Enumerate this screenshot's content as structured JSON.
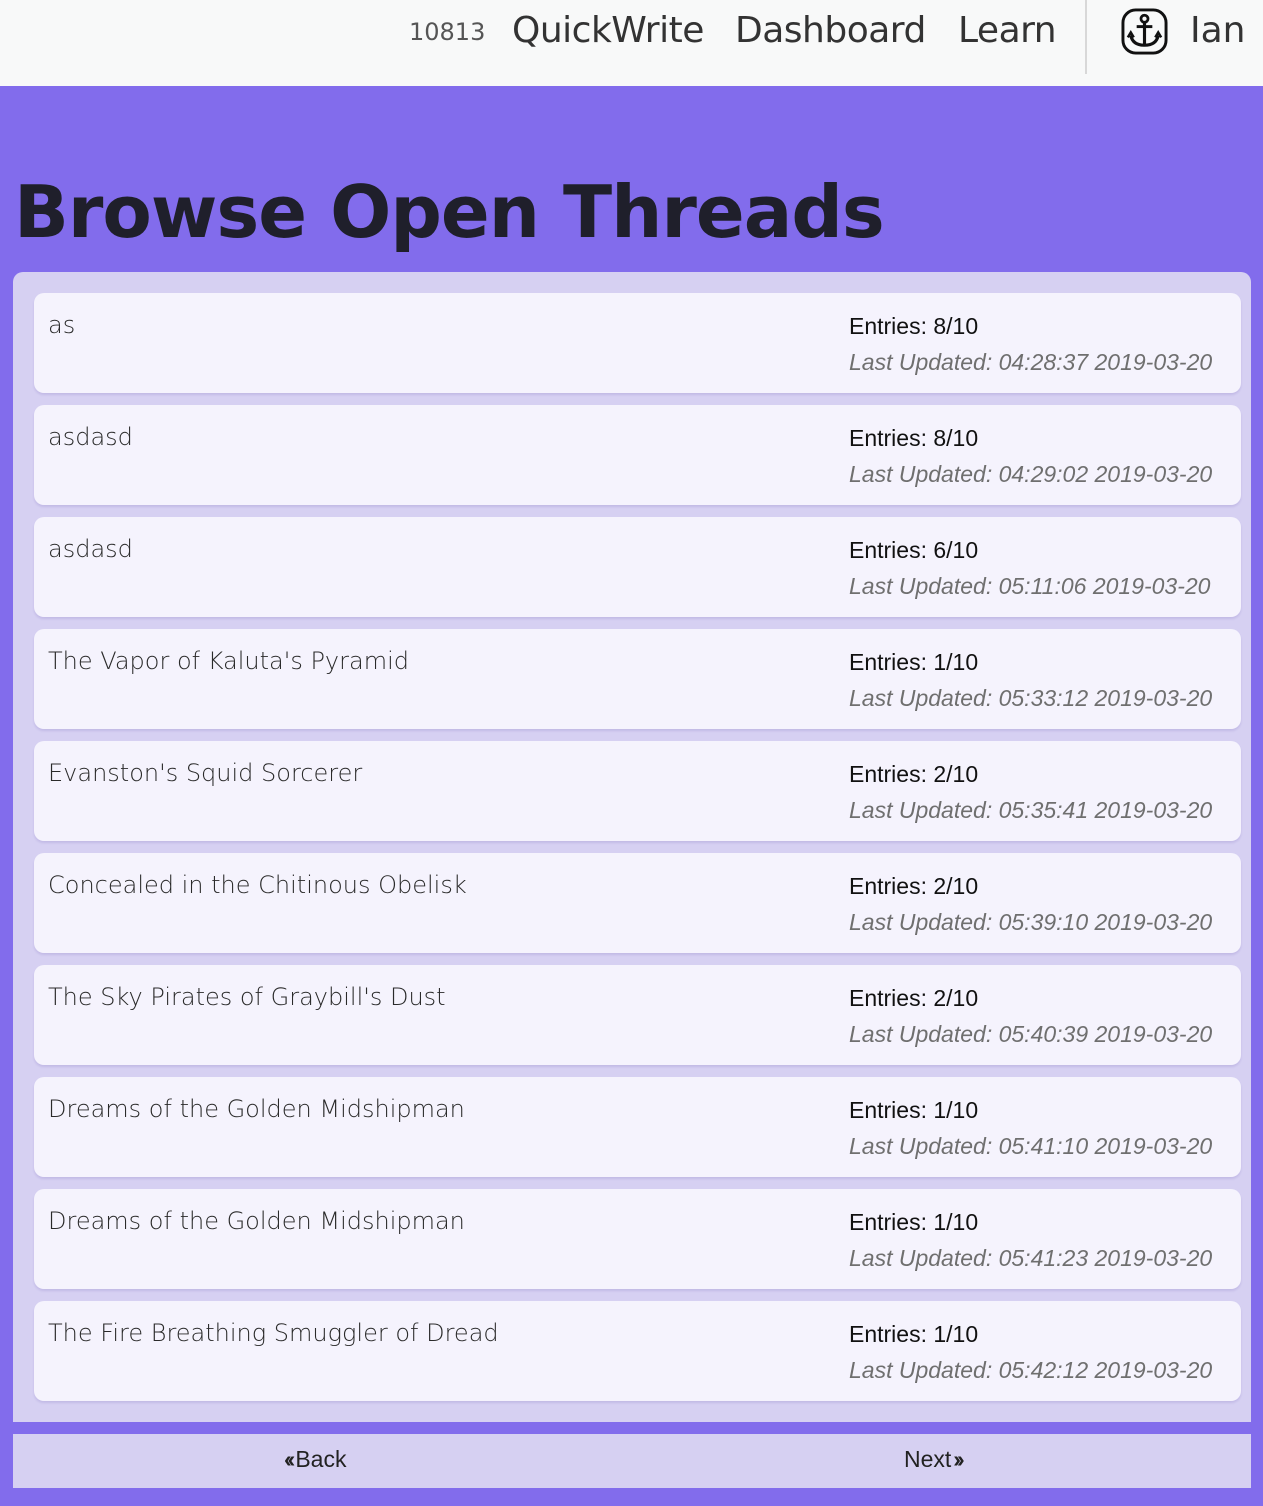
{
  "nav": {
    "count": "10813",
    "links": [
      "QuickWrite",
      "Dashboard",
      "Learn"
    ],
    "user_icon": "anchor-icon",
    "user_name": "Ian"
  },
  "page": {
    "title": "Browse Open Threads"
  },
  "threads": [
    {
      "title": "as",
      "entries": "Entries: 8/10",
      "updated": "Last Updated: 04:28:37 2019-03-20"
    },
    {
      "title": "asdasd",
      "entries": "Entries: 8/10",
      "updated": "Last Updated: 04:29:02 2019-03-20"
    },
    {
      "title": "asdasd",
      "entries": "Entries: 6/10",
      "updated": "Last Updated: 05:11:06 2019-03-20"
    },
    {
      "title": "The Vapor of Kaluta's Pyramid",
      "entries": "Entries: 1/10",
      "updated": "Last Updated: 05:33:12 2019-03-20"
    },
    {
      "title": "Evanston's Squid Sorcerer",
      "entries": "Entries: 2/10",
      "updated": "Last Updated: 05:35:41 2019-03-20"
    },
    {
      "title": "Concealed in the Chitinous Obelisk",
      "entries": "Entries: 2/10",
      "updated": "Last Updated: 05:39:10 2019-03-20"
    },
    {
      "title": "The Sky Pirates of Graybill's Dust",
      "entries": "Entries: 2/10",
      "updated": "Last Updated: 05:40:39 2019-03-20"
    },
    {
      "title": "Dreams of the Golden Midshipman",
      "entries": "Entries: 1/10",
      "updated": "Last Updated: 05:41:10 2019-03-20"
    },
    {
      "title": "Dreams of the Golden Midshipman",
      "entries": "Entries: 1/10",
      "updated": "Last Updated: 05:41:23 2019-03-20"
    },
    {
      "title": "The Fire Breathing Smuggler of Dread",
      "entries": "Entries: 1/10",
      "updated": "Last Updated: 05:42:12 2019-03-20"
    }
  ],
  "pager": {
    "back_label": "Back",
    "next_label": "Next",
    "back_icon": "double-chevron-left-icon",
    "next_icon": "double-chevron-right-icon"
  },
  "colors": {
    "page_background": "#826cec",
    "panel_background": "#d6d0f2",
    "card_background": "#f5f3fd"
  }
}
